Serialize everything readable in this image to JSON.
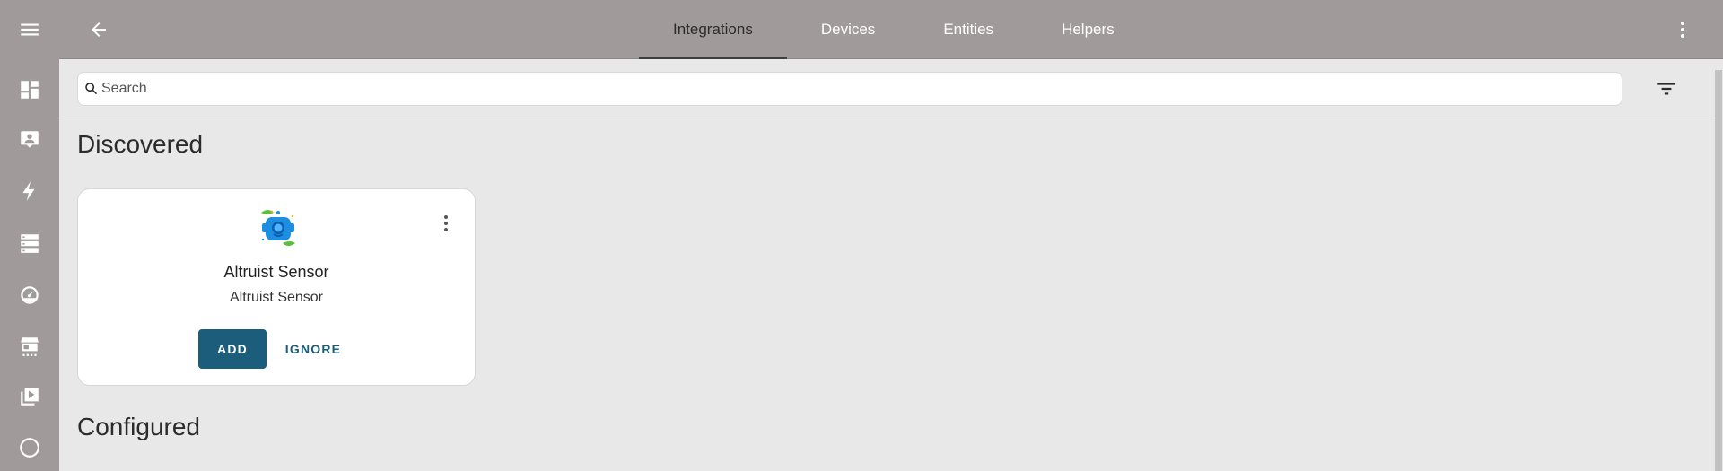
{
  "sidebar": {
    "items": [
      {
        "icon": "menu-icon"
      },
      {
        "icon": "dashboard-icon"
      },
      {
        "icon": "account-box-icon"
      },
      {
        "icon": "lightning-icon"
      },
      {
        "icon": "server-list-icon"
      },
      {
        "icon": "speedometer-icon"
      },
      {
        "icon": "hacs-store-icon"
      },
      {
        "icon": "media-play-icon"
      },
      {
        "icon": "zwave-icon"
      }
    ]
  },
  "header": {
    "tabs": [
      {
        "label": "Integrations",
        "active": true
      },
      {
        "label": "Devices",
        "active": false
      },
      {
        "label": "Entities",
        "active": false
      },
      {
        "label": "Helpers",
        "active": false
      }
    ]
  },
  "search": {
    "placeholder": "Search",
    "value": ""
  },
  "sections": {
    "discovered": "Discovered",
    "configured": "Configured"
  },
  "discovered_card": {
    "title": "Altruist Sensor",
    "subtitle": "Altruist Sensor",
    "add_label": "ADD",
    "ignore_label": "IGNORE"
  },
  "colors": {
    "topbar": "#a09b9a",
    "background": "#e8e8e8",
    "accent": "#1b5d7a"
  }
}
